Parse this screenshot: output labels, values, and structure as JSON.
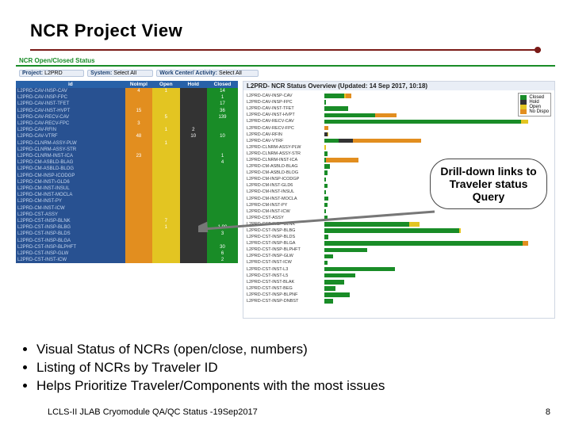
{
  "title": "NCR  Project View",
  "dash": {
    "title": "NCR Open/Closed Status",
    "filters": {
      "project_label": "Project:",
      "project_value": "L2PRD",
      "system_label": "System:",
      "system_value": "Select All",
      "wc_label": "Work Center/ Activity:",
      "wc_value": "Select All"
    },
    "table_headers": [
      "id",
      "NoImpl",
      "Open",
      "Hold",
      "Closed"
    ],
    "rows": [
      {
        "id": "L2PRD-CAV-INSP-CAV",
        "no": "4",
        "open": "1",
        "hold": "",
        "closed": "14"
      },
      {
        "id": "L2PRD-CAV-INSP-FPC",
        "no": "",
        "open": "",
        "hold": "",
        "closed": "1"
      },
      {
        "id": "L2PRD-CAV-INST-TFET",
        "no": "",
        "open": "",
        "hold": "",
        "closed": "17"
      },
      {
        "id": "L2PRD-CAV-INST-HVPT",
        "no": "15",
        "open": "",
        "hold": "",
        "closed": "36"
      },
      {
        "id": "L2PRD-CAV-RECV-CAV",
        "no": "",
        "open": "5",
        "hold": "",
        "closed": "139"
      },
      {
        "id": "L2PRD-CAV-RECV-FPC",
        "no": "3",
        "open": "",
        "hold": "",
        "closed": ""
      },
      {
        "id": "L2PRD-CAV-RFIN",
        "no": "",
        "open": "1",
        "hold": "2",
        "closed": ""
      },
      {
        "id": "L2PRD-CAV-VTRF",
        "no": "48",
        "open": "",
        "hold": "10",
        "closed": "10"
      },
      {
        "id": "L2PRD-CLNRM-ASSY-PLW",
        "no": "",
        "open": "1",
        "hold": "",
        "closed": ""
      },
      {
        "id": "L2PRD-CLNRM-ASSY-STR",
        "no": "",
        "open": "",
        "hold": "",
        "closed": ""
      },
      {
        "id": "L2PRD-CLNRM-INST-ICA",
        "no": "23",
        "open": "",
        "hold": "",
        "closed": "1"
      },
      {
        "id": "L2PRD-CM-ASBLD-BLAG",
        "no": "",
        "open": "",
        "hold": "",
        "closed": "4"
      },
      {
        "id": "L2PRD-CM-ASBLD-BLOG",
        "no": "",
        "open": "",
        "hold": "",
        "closed": ""
      },
      {
        "id": "L2PRD-CM-INSP-ICODGP",
        "no": "",
        "open": "",
        "hold": "",
        "closed": ""
      },
      {
        "id": "L2PRD-CM-INST\\-GLD6",
        "no": "",
        "open": "",
        "hold": "",
        "closed": ""
      },
      {
        "id": "L2PRD-CM-INST-INSUL",
        "no": "",
        "open": "",
        "hold": "",
        "closed": ""
      },
      {
        "id": "L2PRD-CM-INST-MOCLA",
        "no": "",
        "open": "",
        "hold": "",
        "closed": ""
      },
      {
        "id": "L2PRD-CM-INST-PY",
        "no": "",
        "open": "",
        "hold": "",
        "closed": ""
      },
      {
        "id": "L2PRD-CM-INST-ICW",
        "no": "",
        "open": "",
        "hold": "",
        "closed": ""
      },
      {
        "id": "L2PRD-CST-ASSY",
        "no": "",
        "open": "",
        "hold": "",
        "closed": ""
      },
      {
        "id": "L2PRD-CST-INSP-BLNK",
        "no": "",
        "open": "7",
        "hold": "",
        "closed": ""
      },
      {
        "id": "L2PRD-CST-INSP-BLBG",
        "no": "",
        "open": "1",
        "hold": "",
        "closed": "1.90"
      },
      {
        "id": "L2PRD-CST-INSP-BLDS",
        "no": "",
        "open": "",
        "hold": "",
        "closed": "3"
      },
      {
        "id": "L2PRD-CST-INSP-BLGA",
        "no": "",
        "open": "",
        "hold": "",
        "closed": ""
      },
      {
        "id": "L2PRD-CST-INSP-BLPHFT",
        "no": "",
        "open": "",
        "hold": "",
        "closed": "30"
      },
      {
        "id": "L2PRD-CST-INSP-GLW",
        "no": "",
        "open": "",
        "hold": "",
        "closed": "6"
      },
      {
        "id": "L2PRD-CST-INST-ICW",
        "no": "",
        "open": "",
        "hold": "",
        "closed": "2"
      }
    ],
    "chart_title": "L2PRD- NCR Status Overview (Updated: 14 Sep 2017, 10:18)",
    "legend": [
      "Closed",
      "Hold",
      "Open",
      "No Dispo"
    ]
  },
  "chart_data": {
    "type": "bar",
    "orientation": "horizontal",
    "stacked": true,
    "title": "L2PRD- NCR Status Overview (Updated: 14 Sep 2017, 10:18)",
    "xlabel": "",
    "ylabel": "",
    "xlim": [
      0,
      160
    ],
    "legend_position": "top-right",
    "series_keys": [
      "closed",
      "hold",
      "open",
      "nodispo"
    ],
    "series_colors": {
      "closed": "#198c27",
      "hold": "#333333",
      "open": "#e3c522",
      "nodispo": "#e28e1f"
    },
    "categories": [
      "L2PRD-CAV-INSP-CAV",
      "L2PRD-CAV-INSP-FPC",
      "L2PRD-CAV-INST-TFET",
      "L2PRD-CAV-INST-HVPT",
      "L2PRD-CAV-RECV-CAV",
      "L2PRD-CAV-RECV-FPC",
      "L2PRD-CAV-RFIN",
      "L2PRD-CAV-VTRF",
      "L2PRD-CLNRM-ASSY-PLW",
      "L2PRD-CLNRM-ASSY-STR",
      "L2PRD-CLNRM-INST-ICA",
      "L2PRD-CM-ASBLD-BLAG",
      "L2PRD-CM-ASBLD-BLOG",
      "L2PRD-CM-INSP-ICODGP",
      "L2PRD-CM-INST-GLD6",
      "L2PRD-CM-INST-INSUL",
      "L2PRD-CM-INST-MOCLA",
      "L2PRD-CM-INST-PY",
      "L2PRD-CM-INST-ICW",
      "L2PRD-CST-ASSY",
      "L2PRD-CST-INSP-BLNK",
      "L2PRD-CST-INSP-BLBG",
      "L2PRD-CST-INSP-BLDS",
      "L2PRD-CST-INSP-BLGA",
      "L2PRD-CST-INSP-BLPHFT",
      "L2PRD-CST-INSP-GLW",
      "L2PRD-CST-INST-ICW",
      "L2PRD-CST-INST-L3",
      "L2PRD-CST-INST-L5",
      "L2PRD-CST-INST-BLAK",
      "L2PRD-CST-INST-BEG",
      "L2PRD-CST-INSP-BLPNF",
      "L2PRD-CST-INSP-DNBST"
    ],
    "data": [
      {
        "closed": 14,
        "hold": 0,
        "open": 1,
        "nodispo": 4
      },
      {
        "closed": 1,
        "hold": 0,
        "open": 0,
        "nodispo": 0
      },
      {
        "closed": 17,
        "hold": 0,
        "open": 0,
        "nodispo": 0
      },
      {
        "closed": 36,
        "hold": 0,
        "open": 0,
        "nodispo": 15
      },
      {
        "closed": 139,
        "hold": 0,
        "open": 5,
        "nodispo": 0
      },
      {
        "closed": 0,
        "hold": 0,
        "open": 0,
        "nodispo": 3
      },
      {
        "closed": 0,
        "hold": 2,
        "open": 1,
        "nodispo": 0
      },
      {
        "closed": 10,
        "hold": 10,
        "open": 0,
        "nodispo": 48
      },
      {
        "closed": 0,
        "hold": 0,
        "open": 1,
        "nodispo": 0
      },
      {
        "closed": 2,
        "hold": 0,
        "open": 0,
        "nodispo": 0
      },
      {
        "closed": 1,
        "hold": 0,
        "open": 0,
        "nodispo": 23
      },
      {
        "closed": 4,
        "hold": 0,
        "open": 0,
        "nodispo": 0
      },
      {
        "closed": 2,
        "hold": 0,
        "open": 0,
        "nodispo": 0
      },
      {
        "closed": 1,
        "hold": 0,
        "open": 0,
        "nodispo": 0
      },
      {
        "closed": 2,
        "hold": 0,
        "open": 0,
        "nodispo": 0
      },
      {
        "closed": 1,
        "hold": 0,
        "open": 0,
        "nodispo": 0
      },
      {
        "closed": 3,
        "hold": 0,
        "open": 0,
        "nodispo": 0
      },
      {
        "closed": 2,
        "hold": 0,
        "open": 0,
        "nodispo": 0
      },
      {
        "closed": 1,
        "hold": 0,
        "open": 0,
        "nodispo": 0
      },
      {
        "closed": 2,
        "hold": 0,
        "open": 0,
        "nodispo": 0
      },
      {
        "closed": 60,
        "hold": 0,
        "open": 7,
        "nodispo": 0
      },
      {
        "closed": 95,
        "hold": 0,
        "open": 1,
        "nodispo": 0
      },
      {
        "closed": 3,
        "hold": 0,
        "open": 0,
        "nodispo": 0
      },
      {
        "closed": 140,
        "hold": 0,
        "open": 0,
        "nodispo": 4
      },
      {
        "closed": 30,
        "hold": 0,
        "open": 0,
        "nodispo": 0
      },
      {
        "closed": 6,
        "hold": 0,
        "open": 0,
        "nodispo": 0
      },
      {
        "closed": 2,
        "hold": 0,
        "open": 0,
        "nodispo": 0
      },
      {
        "closed": 50,
        "hold": 0,
        "open": 0,
        "nodispo": 0
      },
      {
        "closed": 22,
        "hold": 0,
        "open": 0,
        "nodispo": 0
      },
      {
        "closed": 14,
        "hold": 0,
        "open": 0,
        "nodispo": 0
      },
      {
        "closed": 8,
        "hold": 0,
        "open": 0,
        "nodispo": 0
      },
      {
        "closed": 18,
        "hold": 0,
        "open": 0,
        "nodispo": 0
      },
      {
        "closed": 6,
        "hold": 0,
        "open": 0,
        "nodispo": 0
      }
    ]
  },
  "callout": "Drill-down links to Traveler status Query",
  "bullets": [
    "Visual  Status of NCRs (open/close, numbers)",
    "Listing of NCRs by Traveler ID",
    "Helps Prioritize Traveler/Components with the most issues"
  ],
  "footer_left": "LCLS-II JLAB Cryomodule QA/QC Status -19Sep2017",
  "footer_right": "8",
  "colors": {
    "closed": "#198c27",
    "hold": "#333333",
    "open": "#e3c522",
    "nodispo": "#e28e1f"
  }
}
